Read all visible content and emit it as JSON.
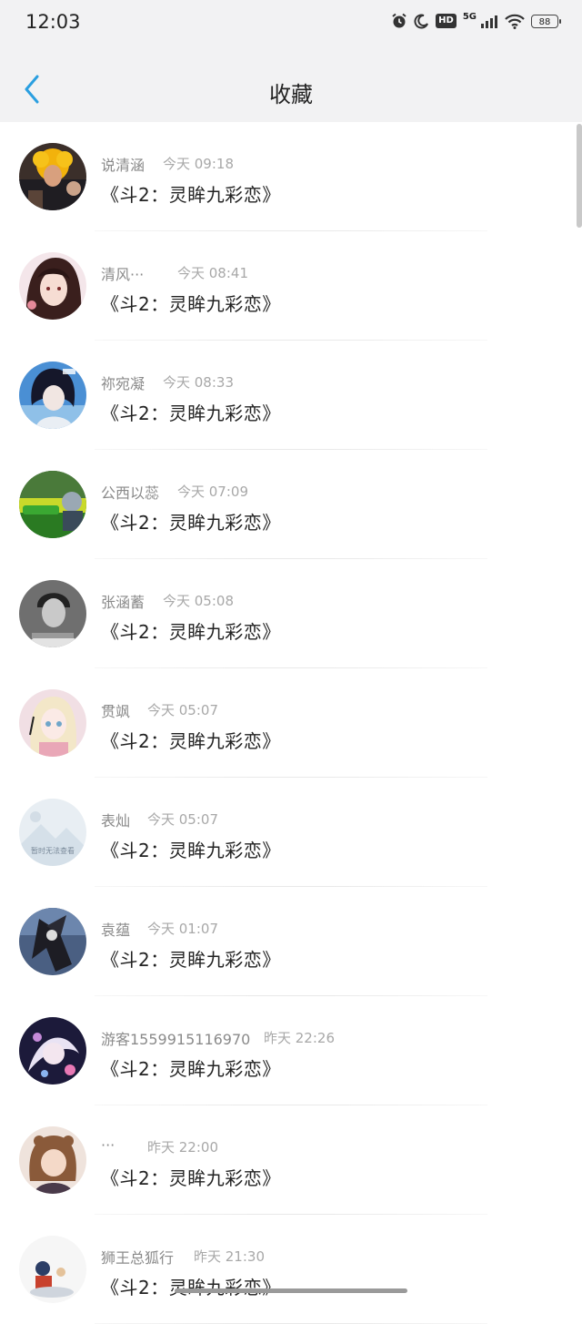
{
  "status": {
    "time": "12:03",
    "hd": "HD",
    "network": "5G",
    "battery": "88"
  },
  "header": {
    "title": "收藏"
  },
  "items": [
    {
      "user": "说清涵",
      "time": "今天 09:18",
      "title": "《斗2：灵眸九彩恋》"
    },
    {
      "user": "清风···",
      "time": "今天 08:41",
      "title": "《斗2：灵眸九彩恋》"
    },
    {
      "user": "祢宛凝",
      "time": "今天 08:33",
      "title": "《斗2：灵眸九彩恋》"
    },
    {
      "user": "公西以蕊",
      "time": "今天 07:09",
      "title": "《斗2：灵眸九彩恋》"
    },
    {
      "user": "张涵蓄",
      "time": "今天 05:08",
      "title": "《斗2：灵眸九彩恋》"
    },
    {
      "user": "贯飒",
      "time": "今天 05:07",
      "title": "《斗2：灵眸九彩恋》"
    },
    {
      "user": "表灿",
      "time": "今天 05:07",
      "title": "《斗2：灵眸九彩恋》",
      "avatar_text": "暂时无法查看"
    },
    {
      "user": "袁蕴",
      "time": "今天 01:07",
      "title": "《斗2：灵眸九彩恋》"
    },
    {
      "user": "游客1559915116970",
      "time": "昨天 22:26",
      "title": "《斗2：灵眸九彩恋》"
    },
    {
      "user": "···",
      "time": "昨天 22:00",
      "title": "《斗2：灵眸九彩恋》"
    },
    {
      "user": "狮王总狐行",
      "time": "昨天 21:30",
      "title": "《斗2：灵眸九彩恋》"
    }
  ]
}
